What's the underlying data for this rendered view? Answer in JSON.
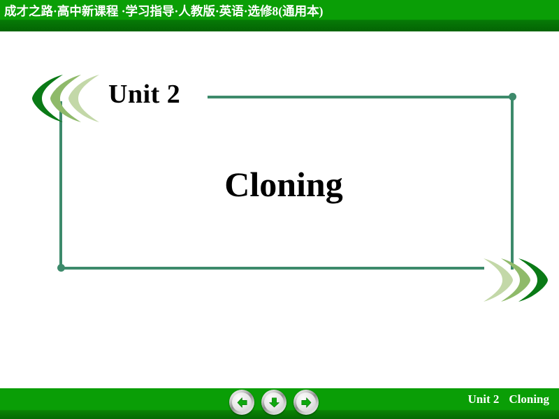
{
  "header": {
    "title": "成才之路·高中新课程 ·学习指导·人教版·英语·选修8(通用本)",
    "bg_color_top": "#0a9e06",
    "bg_color_bottom": "#046404",
    "text_color": "#ffffff"
  },
  "slide": {
    "unit_label": "Unit 2",
    "main_title": "Cloning",
    "frame_color": "#3d8a6b",
    "decoration": {
      "left_chevrons": {
        "name": "left-pointing-crescents",
        "colors": [
          "#0a7a16",
          "#8fba6a",
          "#c3d8a8"
        ]
      },
      "right_chevrons": {
        "name": "right-pointing-crescents",
        "colors": [
          "#c3d8a8",
          "#8fba6a",
          "#0a7a16"
        ]
      }
    }
  },
  "footer": {
    "unit_label": "Unit 2",
    "title_label": "Cloning",
    "bg_color_top": "#0a9e06",
    "bg_color_bottom": "#046a04",
    "text_color": "#ffffff",
    "nav": {
      "prev": {
        "icon": "arrow-left-icon",
        "label": "Previous slide"
      },
      "down": {
        "icon": "arrow-down-icon",
        "label": "Next section"
      },
      "next": {
        "icon": "arrow-right-icon",
        "label": "Next slide"
      }
    }
  }
}
